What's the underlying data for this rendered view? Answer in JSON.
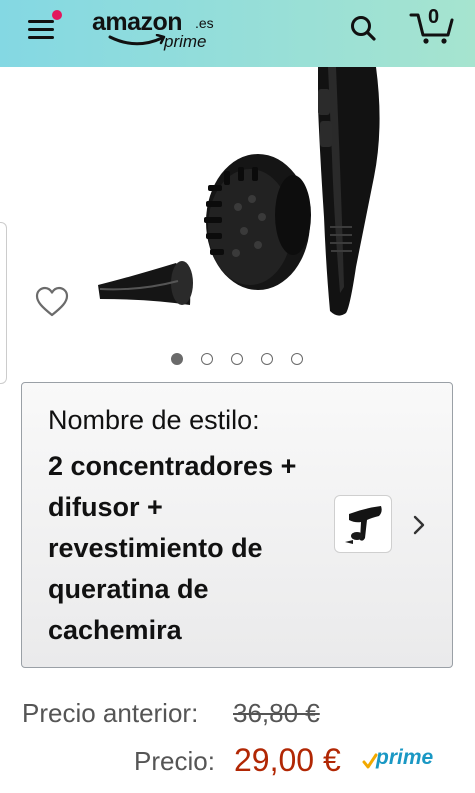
{
  "header": {
    "logo_word": "amazon",
    "logo_tld": ".es",
    "logo_prime": "prime",
    "cart_count": "0"
  },
  "gallery": {
    "dots_total": 5,
    "active_dot": 1
  },
  "style_selector": {
    "label": "Nombre de estilo:",
    "value": "2 concentradores + difusor + revestimiento de queratina de cachemira"
  },
  "pricing": {
    "previous_label": "Precio anterior:",
    "previous_value": "36,80 €",
    "price_label": "Precio:",
    "price_value": "29,00 €",
    "prime_badge": "prime"
  },
  "colors": {
    "price": "#b12704",
    "prime": "#1a98c4",
    "header_start": "#84d8e3",
    "header_end": "#a6e4cf",
    "notification_dot": "#e3175d"
  },
  "icons": [
    "menu-icon",
    "search-icon",
    "cart-icon",
    "heart-icon",
    "chevron-right-icon",
    "prime-check-icon"
  ]
}
